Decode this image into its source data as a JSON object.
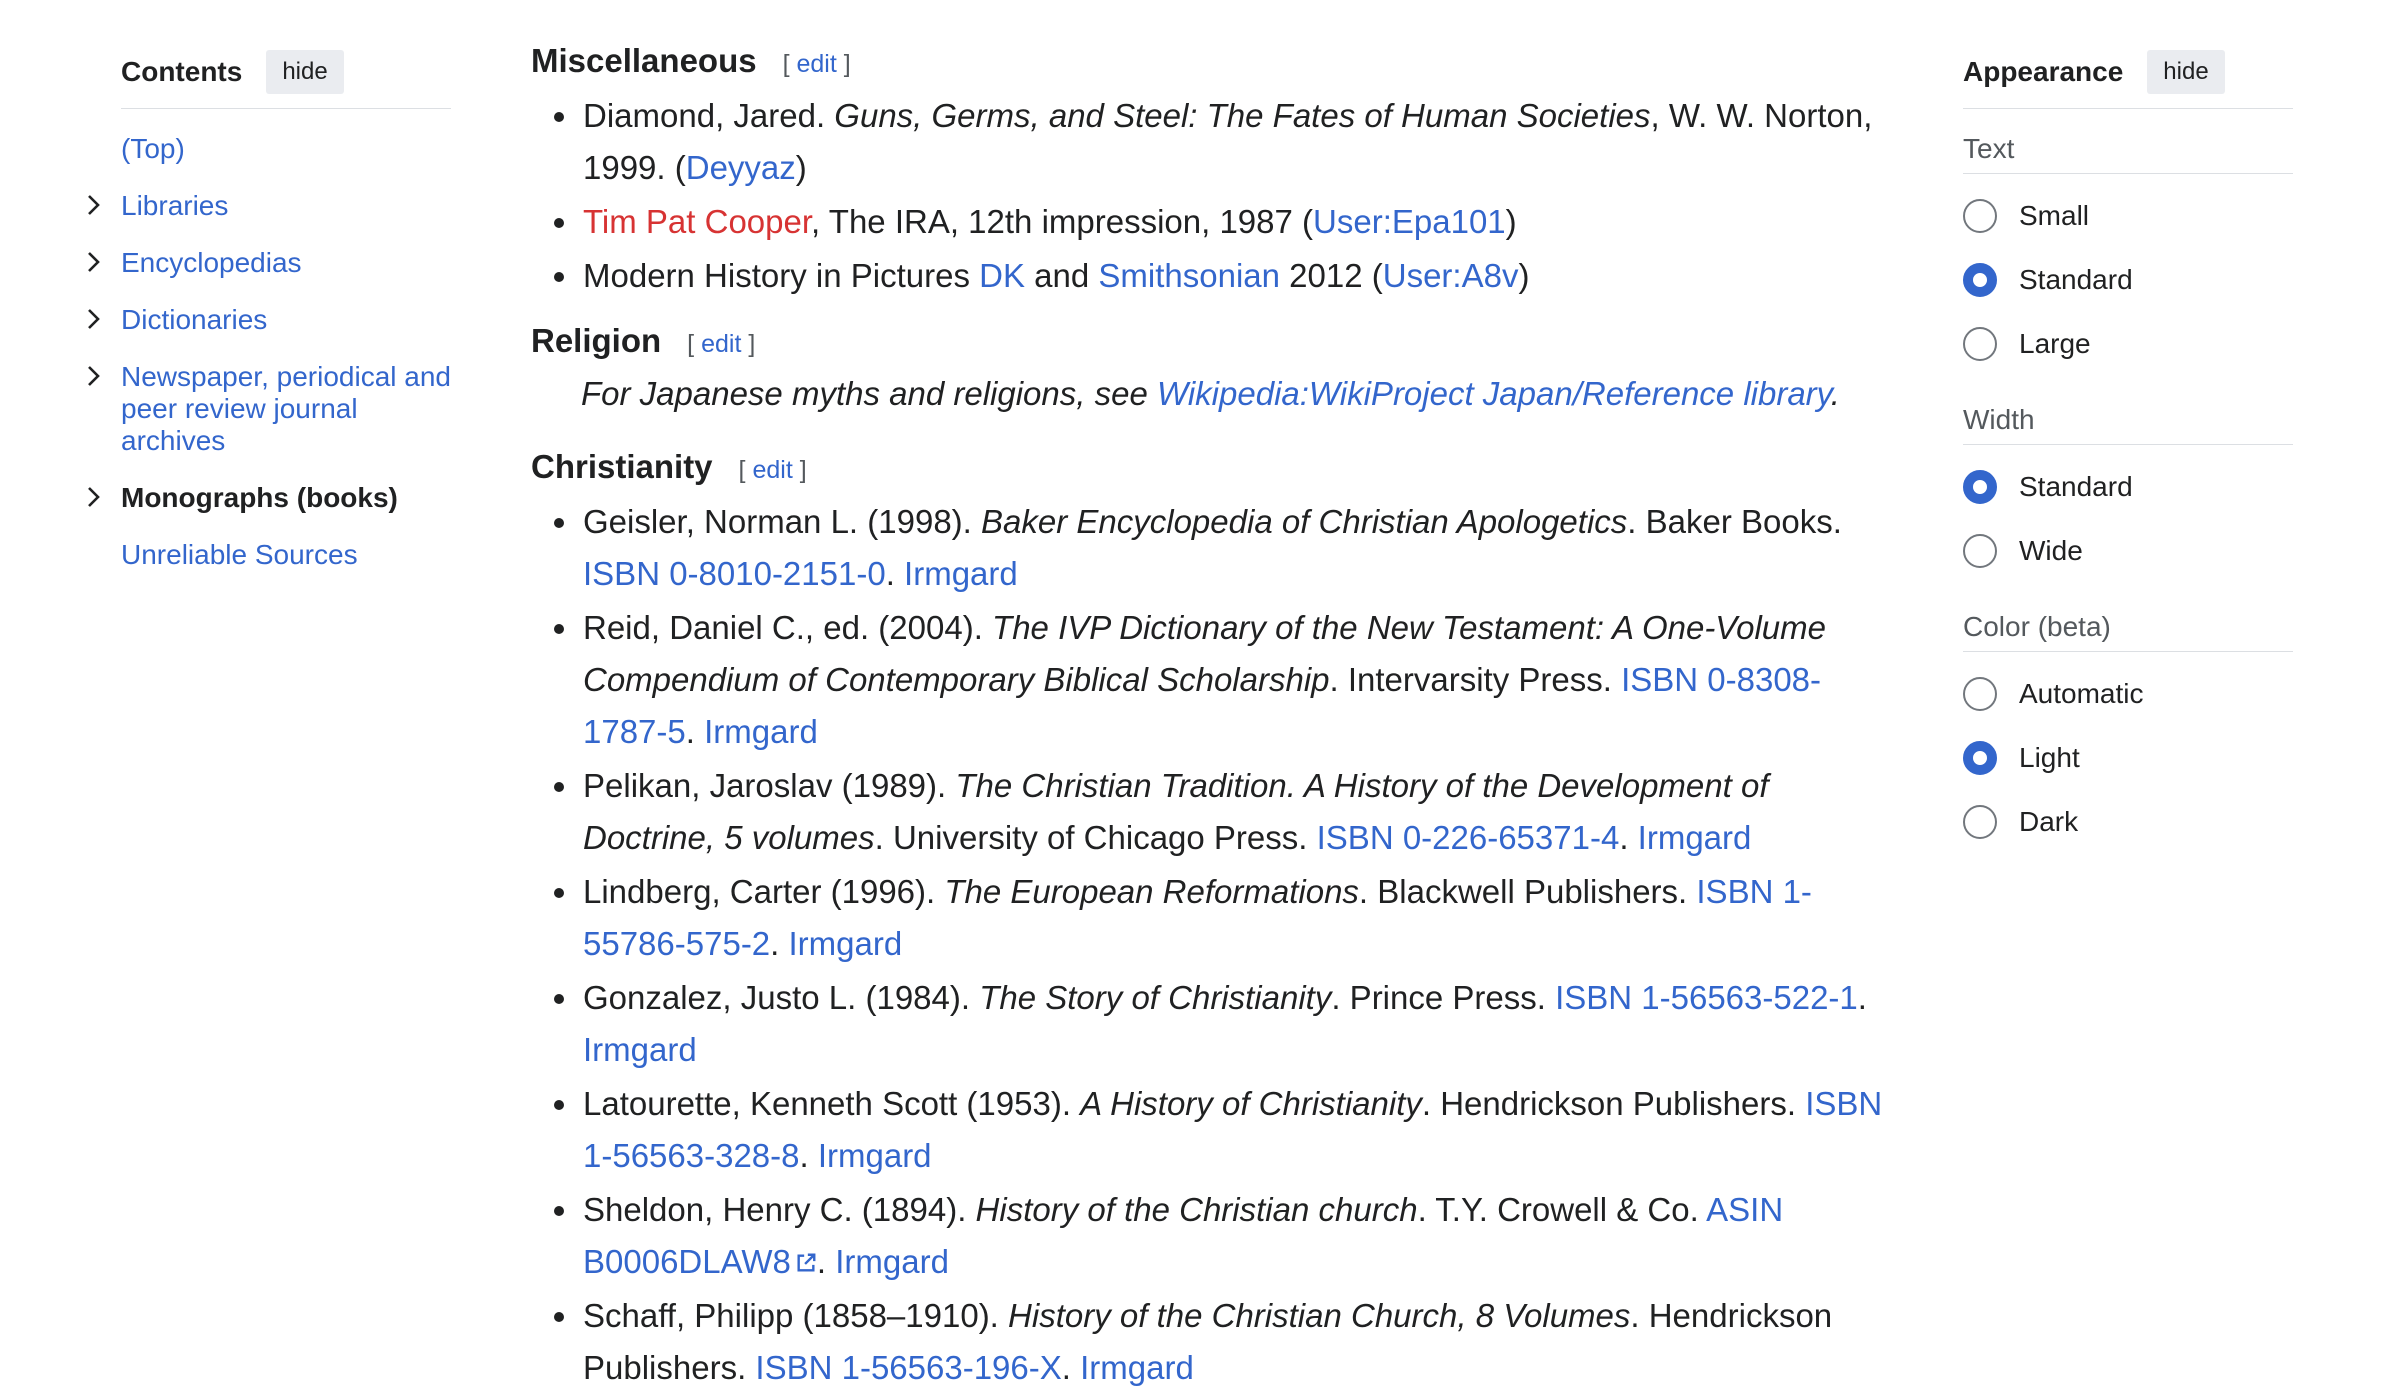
{
  "toc": {
    "title": "Contents",
    "hide_label": "hide",
    "items": [
      {
        "label": "(Top)"
      },
      {
        "label": "Libraries"
      },
      {
        "label": "Encyclopedias"
      },
      {
        "label": "Dictionaries"
      },
      {
        "label": "Newspaper, periodical and peer review journal archives"
      },
      {
        "label": "Monographs (books)"
      },
      {
        "label": "Unreliable Sources"
      }
    ]
  },
  "appearance": {
    "title": "Appearance",
    "hide_label": "hide",
    "text_label": "Text",
    "text_options": [
      "Small",
      "Standard",
      "Large"
    ],
    "text_selected": "Standard",
    "width_label": "Width",
    "width_options": [
      "Standard",
      "Wide"
    ],
    "width_selected": "Standard",
    "color_label": "Color (beta)",
    "color_options": [
      "Automatic",
      "Light",
      "Dark"
    ],
    "color_selected": "Light",
    "accent_color": "#3366cc"
  },
  "main": {
    "misc": {
      "heading": "Miscellaneous",
      "edit": "edit",
      "items": {
        "diamond": {
          "pre": "Diamond, Jared. ",
          "title": "Guns, Germs, and Steel: The Fates of Human Societies",
          "post": ", W. W. Norton, 1999. (",
          "user": "Deyyaz",
          "end": ")"
        },
        "cooper": {
          "author": "Tim Pat Cooper",
          "text": ", The IRA, 12th impression, 1987 (",
          "user": "User:Epa101",
          "end": ")"
        },
        "modern": {
          "pre": "Modern History in Pictures ",
          "link1": "DK",
          "and": " and ",
          "link2": "Smithsonian",
          "text": " 2012 (",
          "user": "User:A8v",
          "end": ")"
        }
      }
    },
    "religion": {
      "heading": "Religion",
      "edit": "edit",
      "note_pre": "For Japanese myths and religions, see ",
      "note_link": "Wikipedia:WikiProject Japan/Reference library",
      "note_end": "."
    },
    "christianity": {
      "heading": "Christianity",
      "edit": "edit",
      "items": [
        {
          "pre": "Geisler, Norman L. (1998). ",
          "title": "Baker Encyclopedia of Christian Apologetics",
          "post": ". Baker Books. ",
          "id": "ISBN 0-8010-2151-0",
          "sep": ". ",
          "user": "Irmgard",
          "external": false
        },
        {
          "pre": "Reid, Daniel C., ed. (2004). ",
          "title": "The IVP Dictionary of the New Testament: A One-Volume Compendium of Contemporary Biblical Scholarship",
          "post": ". Intervarsity Press. ",
          "id": "ISBN 0-8308-1787-5",
          "sep": ". ",
          "user": "Irmgard",
          "external": false
        },
        {
          "pre": "Pelikan, Jaroslav (1989). ",
          "title": "The Christian Tradition. A History of the Development of Doctrine, 5 volumes",
          "post": ". University of Chicago Press. ",
          "id": "ISBN 0-226-65371-4",
          "sep": ". ",
          "user": "Irmgard",
          "external": false
        },
        {
          "pre": "Lindberg, Carter (1996). ",
          "title": "The European Reformations",
          "post": ". Blackwell Publishers. ",
          "id": "ISBN 1-55786-575-2",
          "sep": ". ",
          "user": "Irmgard",
          "external": false
        },
        {
          "pre": "Gonzalez, Justo L. (1984). ",
          "title": "The Story of Christianity",
          "post": ". Prince Press. ",
          "id": "ISBN 1-56563-522-1",
          "sep": ". ",
          "user": "Irmgard",
          "external": false
        },
        {
          "pre": "Latourette, Kenneth Scott (1953). ",
          "title": "A History of Christianity",
          "post": ". Hendrickson Publishers. ",
          "id": "ISBN 1-56563-328-8",
          "sep": ". ",
          "user": "Irmgard",
          "external": false
        },
        {
          "pre": "Sheldon, Henry C. (1894). ",
          "title": "History of the Christian church",
          "post": ". T.Y. Crowell & Co. ",
          "id": "ASIN B0006DLAW8",
          "sep": ". ",
          "user": "Irmgard",
          "external": true
        },
        {
          "pre": "Schaff, Philipp (1858–1910). ",
          "title": "History of the Christian Church, 8 Volumes",
          "post": ". Hendrickson Publishers. ",
          "id": "ISBN 1-56563-196-X",
          "sep": ". ",
          "user": "Irmgard",
          "external": false
        }
      ]
    }
  }
}
